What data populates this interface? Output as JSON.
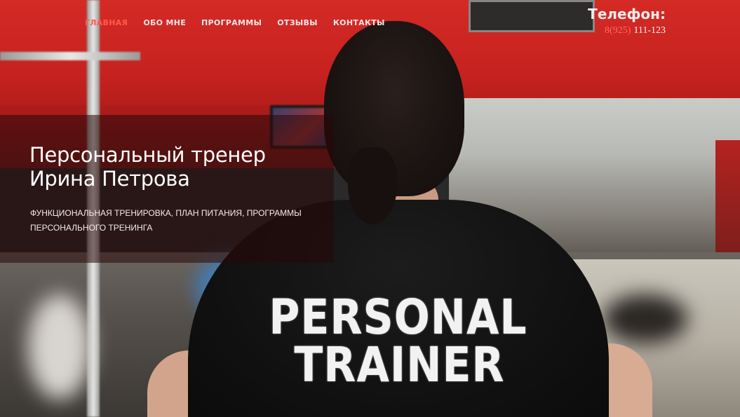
{
  "nav": {
    "items": [
      {
        "label": "ГЛАВНАЯ",
        "active": true
      },
      {
        "label": "ОБО МНЕ",
        "active": false
      },
      {
        "label": "ПРОГРАММЫ",
        "active": false
      },
      {
        "label": "ОТЗЫВЫ",
        "active": false
      },
      {
        "label": "КОНТАКТЫ",
        "active": false
      }
    ]
  },
  "contact": {
    "phone_title": "Телефон:",
    "phone_code": "8(925)",
    "phone_rest": "111-123"
  },
  "hero": {
    "title_line1": "Персональный тренер",
    "title_line2": "Ирина Петрова",
    "subtitle": "ФУНКЦИОНАЛЬНАЯ ТРЕНИРОВКА, ПЛАН ПИТАНИЯ, ПРОГРАММЫ ПЕРСОНАЛЬНОГО ТРЕНИНГА",
    "shirt_line1": "PERSONAL",
    "shirt_line2": "TRAINER"
  },
  "colors": {
    "accent": "#ff5a4a",
    "wall": "#d42a26",
    "panel_overlay": "rgba(40, 8, 8, 0.55)"
  }
}
